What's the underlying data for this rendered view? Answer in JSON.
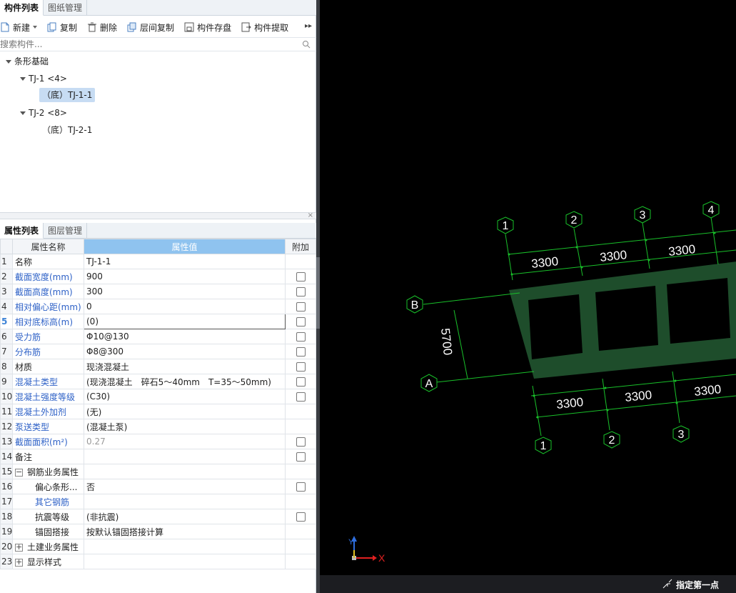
{
  "top_tabs": [
    {
      "label": "构件列表",
      "active": true
    },
    {
      "label": "图纸管理",
      "active": false
    }
  ],
  "toolbar": {
    "new": "新建",
    "copy": "复制",
    "delete": "删除",
    "floor_copy": "层间复制",
    "save_component": "构件存盘",
    "extract_component": "构件提取"
  },
  "search": {
    "placeholder": "搜索构件..."
  },
  "tree": {
    "root": "条形基础",
    "groups": [
      {
        "label": "TJ-1 <4>",
        "children": [
          "（底）TJ-1-1"
        ]
      },
      {
        "label": "TJ-2 <8>",
        "children": [
          "（底）TJ-2-1"
        ]
      }
    ]
  },
  "bottom_tabs": [
    {
      "label": "属性列表",
      "active": true
    },
    {
      "label": "图层管理",
      "active": false
    }
  ],
  "prop_headers": {
    "name": "属性名称",
    "value": "属性值",
    "extra": "附加"
  },
  "props": [
    {
      "n": "1",
      "name": "名称",
      "value": "TJ-1-1"
    },
    {
      "n": "2",
      "name": "截面宽度(mm)",
      "value": "900"
    },
    {
      "n": "3",
      "name": "截面高度(mm)",
      "value": "300"
    },
    {
      "n": "4",
      "name": "相对偏心距(mm)",
      "value": "0"
    },
    {
      "n": "5",
      "name": "相对底标高(m)",
      "value": "(0)"
    },
    {
      "n": "6",
      "name": "受力筋",
      "value": "Φ10@130"
    },
    {
      "n": "7",
      "name": "分布筋",
      "value": "Φ8@300"
    },
    {
      "n": "8",
      "name": "材质",
      "value": "现浇混凝土"
    },
    {
      "n": "9",
      "name": "混凝土类型",
      "value": "(现浇混凝土　碎石5～40mm　T=35～50mm)"
    },
    {
      "n": "10",
      "name": "混凝土强度等级",
      "value": "(C30)"
    },
    {
      "n": "11",
      "name": "混凝土外加剂",
      "value": "(无)"
    },
    {
      "n": "12",
      "name": "泵送类型",
      "value": "(混凝土泵)"
    },
    {
      "n": "13",
      "name": "截面面积(m²)",
      "value": "0.27"
    },
    {
      "n": "14",
      "name": "备注",
      "value": ""
    },
    {
      "n": "15",
      "name": "钢筋业务属性",
      "value": ""
    },
    {
      "n": "16",
      "name": "偏心条形...",
      "value": "否"
    },
    {
      "n": "17",
      "name": "其它钢筋",
      "value": ""
    },
    {
      "n": "18",
      "name": "抗震等级",
      "value": "(非抗震)"
    },
    {
      "n": "19",
      "name": "锚固搭接",
      "value": "按默认锚固搭接计算"
    },
    {
      "n": "20",
      "name": "土建业务属性",
      "value": ""
    },
    {
      "n": "23",
      "name": "显示样式",
      "value": ""
    }
  ],
  "canvas": {
    "top_axes": [
      "1",
      "2",
      "3",
      "4"
    ],
    "bottom_axes": [
      "1",
      "2",
      "3"
    ],
    "side_axes": [
      "B",
      "A"
    ],
    "top_dims": [
      "3300",
      "3300",
      "3300"
    ],
    "bottom_dims": [
      "3300",
      "3300",
      "3300"
    ],
    "side_dim": "5700",
    "ucs_x": "X",
    "ucs_y": "Y",
    "beam_color": "#1e4d2b",
    "line_color": "#19c02a"
  },
  "status": {
    "prompt": "指定第一点"
  }
}
